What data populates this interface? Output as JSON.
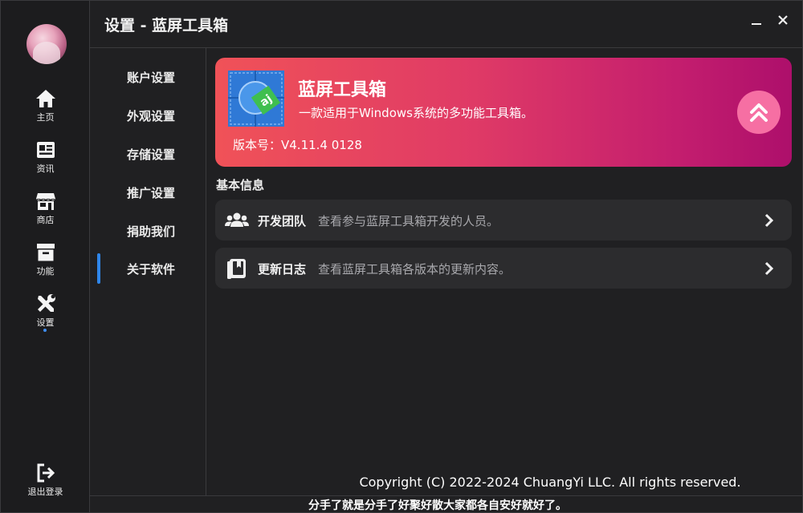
{
  "window": {
    "title": "设置 - 蓝屏工具箱",
    "minimize_icon": "minimize-icon",
    "close_icon": "close-icon"
  },
  "rail": {
    "avatar": "user-avatar",
    "items": [
      {
        "label": "主页",
        "icon": "home-icon"
      },
      {
        "label": "资讯",
        "icon": "news-icon"
      },
      {
        "label": "商店",
        "icon": "store-icon"
      },
      {
        "label": "功能",
        "icon": "archive-icon"
      },
      {
        "label": "设置",
        "icon": "tools-icon",
        "active": true
      }
    ],
    "logout": {
      "label": "退出登录",
      "icon": "logout-icon"
    }
  },
  "nav": {
    "items": [
      {
        "label": "账户设置"
      },
      {
        "label": "外观设置"
      },
      {
        "label": "存储设置"
      },
      {
        "label": "推广设置"
      },
      {
        "label": "捐助我们"
      },
      {
        "label": "关于软件",
        "active": true
      }
    ]
  },
  "hero": {
    "app_name": "蓝屏工具箱",
    "description": "一款适用于Windows系统的多功能工具箱。",
    "version": "版本号：V4.11.4 0128",
    "up_icon": "double-chevron-up-icon"
  },
  "basic_info": {
    "heading": "基本信息",
    "rows": [
      {
        "title": "开发团队",
        "description": "查看参与蓝屏工具箱开发的人员。",
        "icon": "team-icon"
      },
      {
        "title": "更新日志",
        "description": "查看蓝屏工具箱各版本的更新内容。",
        "icon": "book-icon"
      }
    ]
  },
  "footer": {
    "copyright": "Copyright (C) 2022-2024 ChuangYi LLC. All rights reserved.",
    "status": "分手了就是分手了好聚好散大家都各自安好就好了。"
  },
  "colors": {
    "accent": "#2f86ea",
    "hero_start": "#f05258",
    "hero_end": "#ad0f6b",
    "up_button": "#f66fa3"
  }
}
